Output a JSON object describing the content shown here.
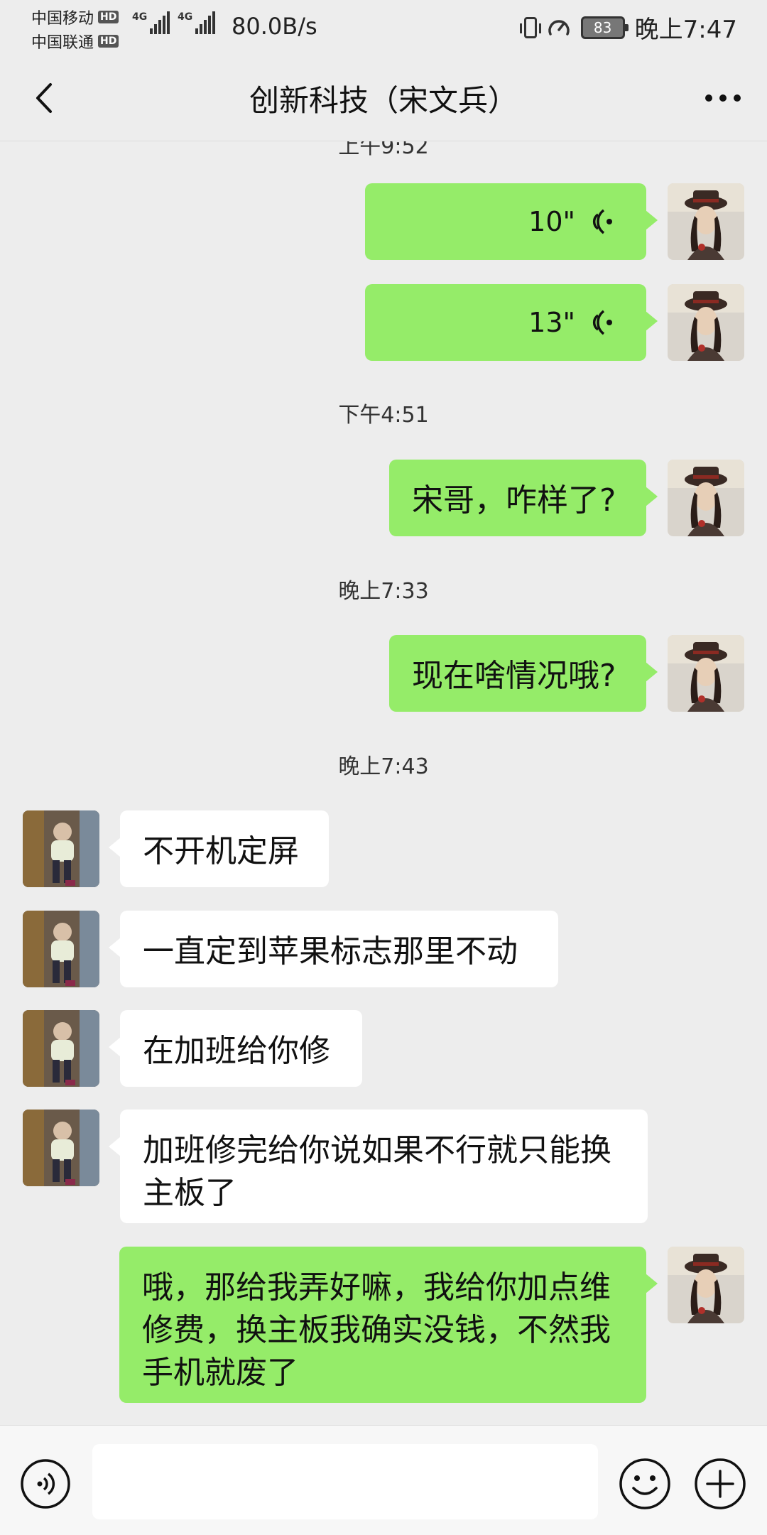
{
  "status_bar": {
    "carrier1": "中国移动",
    "carrier2": "中国联通",
    "hd": "HD",
    "network_tag": "4G",
    "net_speed": "80.0B/s",
    "battery": "83",
    "time": "晚上7:47"
  },
  "header": {
    "title": "创新科技（宋文兵）"
  },
  "messages": {
    "partial_time": "上午9:52",
    "voice1": {
      "duration": "10\""
    },
    "voice2": {
      "duration": "13\""
    },
    "time1": "下午4:51",
    "msg1": "宋哥，咋样了?",
    "time2": "晚上7:33",
    "msg2": "现在啥情况哦?",
    "time3": "晚上7:43",
    "msg3": "不开机定屏",
    "msg4": "一直定到苹果标志那里不动",
    "msg5": "在加班给你修",
    "msg6_line1": "加班修完给你说如果不行就只能换",
    "msg6_line2": "主板了",
    "msg7_line1": "哦，那给我弄好嘛，我给你加点维",
    "msg7_line2": "修费，换主板我确实没钱，不然我",
    "msg7_line3": "手机就废了"
  },
  "input": {
    "placeholder": ""
  },
  "colors": {
    "background": "#ededed",
    "my_bubble": "#95ec69",
    "other_bubble": "#ffffff"
  }
}
